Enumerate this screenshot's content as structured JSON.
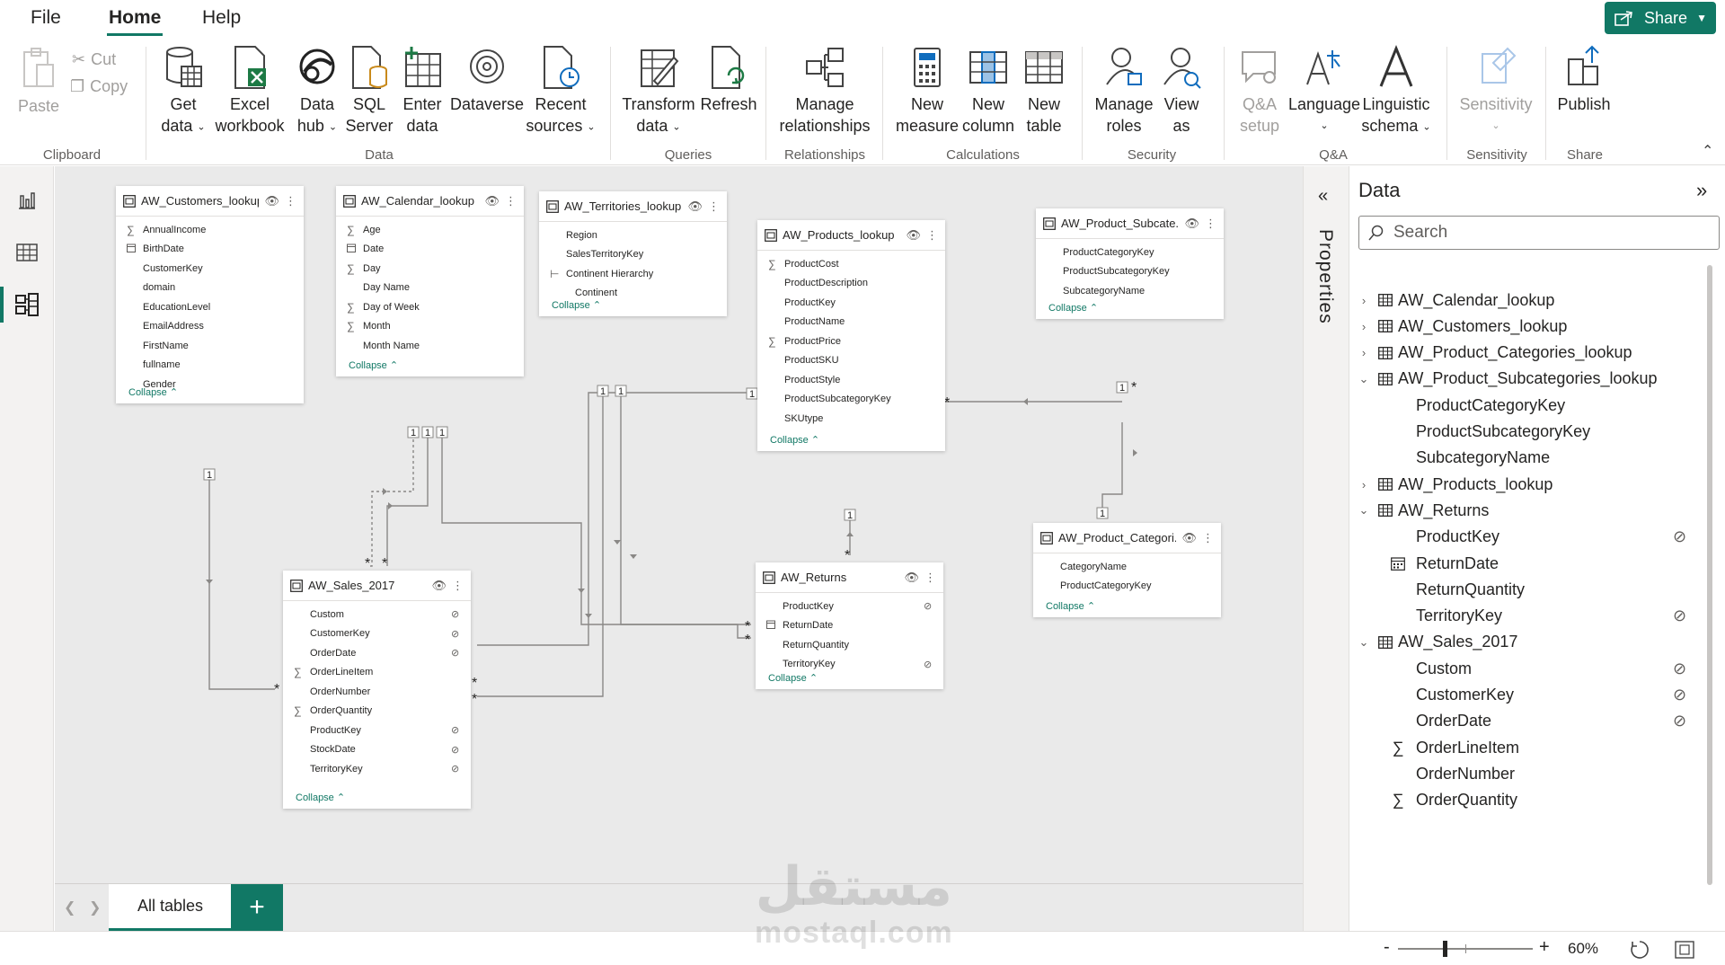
{
  "menu": {
    "tabs": [
      {
        "label": "File"
      },
      {
        "label": "Home"
      },
      {
        "label": "Help"
      }
    ],
    "share_label": "Share"
  },
  "ribbon": {
    "clipboard": {
      "paste": "Paste",
      "cut": "Cut",
      "copy": "Copy",
      "group": "Clipboard"
    },
    "data": {
      "get_data": [
        "Get",
        "data"
      ],
      "excel": [
        "Excel",
        "workbook"
      ],
      "data_hub": [
        "Data",
        "hub"
      ],
      "sql": [
        "SQL",
        "Server"
      ],
      "enter_data": [
        "Enter",
        "data"
      ],
      "dataverse": [
        "Dataverse",
        ""
      ],
      "recent": [
        "Recent",
        "sources"
      ],
      "group": "Data"
    },
    "queries": {
      "transform": [
        "Transform",
        "data"
      ],
      "refresh": [
        "Refresh",
        ""
      ],
      "group": "Queries"
    },
    "relationships": {
      "manage": [
        "Manage",
        "relationships"
      ],
      "group": "Relationships"
    },
    "calculations": {
      "new_measure": [
        "New",
        "measure"
      ],
      "new_column": [
        "New",
        "column"
      ],
      "new_table": [
        "New",
        "table"
      ],
      "group": "Calculations"
    },
    "security": {
      "manage_roles": [
        "Manage",
        "roles"
      ],
      "view_as": [
        "View",
        "as"
      ],
      "group": "Security"
    },
    "qa": {
      "qa_setup": [
        "Q&A",
        "setup"
      ],
      "language": [
        "Language",
        ""
      ],
      "linguistic": [
        "Linguistic",
        "schema"
      ],
      "group": "Q&A"
    },
    "sensitivity": {
      "label": [
        "Sensitivity",
        ""
      ],
      "group": "Sensitivity"
    },
    "share": {
      "publish": [
        "Publish",
        ""
      ],
      "group": "Share"
    }
  },
  "left_nav": [
    {
      "name": "report-view",
      "icon": "bar-chart-icon"
    },
    {
      "name": "table-view",
      "icon": "table-grid-icon"
    },
    {
      "name": "model-view",
      "icon": "model-diagram-icon"
    }
  ],
  "model": {
    "collapse_label": "Collapse",
    "tables": {
      "customers": {
        "title": "AW_Customers_lookup",
        "fields": [
          {
            "icon": "∑",
            "name": "AnnualIncome"
          },
          {
            "icon": "cal",
            "name": "BirthDate"
          },
          {
            "icon": "",
            "name": "CustomerKey"
          },
          {
            "icon": "",
            "name": "domain"
          },
          {
            "icon": "",
            "name": "EducationLevel"
          },
          {
            "icon": "",
            "name": "EmailAddress"
          },
          {
            "icon": "",
            "name": "FirstName"
          },
          {
            "icon": "",
            "name": "fullname"
          },
          {
            "icon": "",
            "name": "Gender"
          }
        ]
      },
      "calendar": {
        "title": "AW_Calendar_lookup",
        "fields": [
          {
            "icon": "∑",
            "name": "Age"
          },
          {
            "icon": "cal",
            "name": "Date"
          },
          {
            "icon": "∑",
            "name": "Day"
          },
          {
            "icon": "",
            "name": "Day Name"
          },
          {
            "icon": "∑",
            "name": "Day of Week"
          },
          {
            "icon": "∑",
            "name": "Month"
          },
          {
            "icon": "",
            "name": "Month Name"
          }
        ]
      },
      "territories": {
        "title": "AW_Territories_lookup",
        "fields": [
          {
            "icon": "",
            "name": "Region"
          },
          {
            "icon": "",
            "name": "SalesTerritoryKey"
          },
          {
            "icon": "hier",
            "name": "Continent Hierarchy"
          },
          {
            "icon": "",
            "name": "Continent",
            "indent": true
          }
        ]
      },
      "products": {
        "title": "AW_Products_lookup",
        "fields": [
          {
            "icon": "∑",
            "name": "ProductCost"
          },
          {
            "icon": "",
            "name": "ProductDescription"
          },
          {
            "icon": "",
            "name": "ProductKey"
          },
          {
            "icon": "",
            "name": "ProductName"
          },
          {
            "icon": "∑",
            "name": "ProductPrice"
          },
          {
            "icon": "",
            "name": "ProductSKU"
          },
          {
            "icon": "",
            "name": "ProductStyle"
          },
          {
            "icon": "",
            "name": "ProductSubcategoryKey"
          },
          {
            "icon": "",
            "name": "SKUtype"
          }
        ]
      },
      "subcategories": {
        "title": "AW_Product_Subcate...",
        "fields": [
          {
            "icon": "",
            "name": "ProductCategoryKey"
          },
          {
            "icon": "",
            "name": "ProductSubcategoryKey"
          },
          {
            "icon": "",
            "name": "SubcategoryName"
          }
        ]
      },
      "categories": {
        "title": "AW_Product_Categori...",
        "fields": [
          {
            "icon": "",
            "name": "CategoryName"
          },
          {
            "icon": "",
            "name": "ProductCategoryKey"
          }
        ]
      },
      "returns": {
        "title": "AW_Returns",
        "fields": [
          {
            "icon": "",
            "name": "ProductKey",
            "hidden": true
          },
          {
            "icon": "cal",
            "name": "ReturnDate"
          },
          {
            "icon": "",
            "name": "ReturnQuantity"
          },
          {
            "icon": "",
            "name": "TerritoryKey",
            "hidden": true
          }
        ]
      },
      "sales": {
        "title": "AW_Sales_2017",
        "fields": [
          {
            "icon": "",
            "name": "Custom",
            "hidden": true
          },
          {
            "icon": "",
            "name": "CustomerKey",
            "hidden": true
          },
          {
            "icon": "",
            "name": "OrderDate",
            "hidden": true
          },
          {
            "icon": "∑",
            "name": "OrderLineItem"
          },
          {
            "icon": "",
            "name": "OrderNumber"
          },
          {
            "icon": "∑",
            "name": "OrderQuantity"
          },
          {
            "icon": "",
            "name": "ProductKey",
            "hidden": true
          },
          {
            "icon": "",
            "name": "StockDate",
            "hidden": true
          },
          {
            "icon": "",
            "name": "TerritoryKey",
            "hidden": true
          }
        ]
      }
    },
    "cardinality": {
      "one": "1",
      "many": "*"
    }
  },
  "pages": {
    "all_tables": "All tables",
    "add": "+"
  },
  "properties_label": "Properties",
  "data_pane": {
    "title": "Data",
    "search_placeholder": "Search",
    "tree": [
      {
        "level": 0,
        "expanded": false,
        "label": "AW_Calendar_lookup"
      },
      {
        "level": 0,
        "expanded": false,
        "label": "AW_Customers_lookup"
      },
      {
        "level": 0,
        "expanded": false,
        "label": "AW_Product_Categories_lookup"
      },
      {
        "level": 0,
        "expanded": true,
        "label": "AW_Product_Subcategories_lookup"
      },
      {
        "level": 1,
        "icon": "",
        "label": "ProductCategoryKey"
      },
      {
        "level": 1,
        "icon": "",
        "label": "ProductSubcategoryKey"
      },
      {
        "level": 1,
        "icon": "",
        "label": "SubcategoryName"
      },
      {
        "level": 0,
        "expanded": false,
        "label": "AW_Products_lookup"
      },
      {
        "level": 0,
        "expanded": true,
        "label": "AW_Returns"
      },
      {
        "level": 1,
        "icon": "",
        "label": "ProductKey",
        "hidden": true
      },
      {
        "level": 1,
        "icon": "cal",
        "label": "ReturnDate"
      },
      {
        "level": 1,
        "icon": "",
        "label": "ReturnQuantity"
      },
      {
        "level": 1,
        "icon": "",
        "label": "TerritoryKey",
        "hidden": true
      },
      {
        "level": 0,
        "expanded": true,
        "label": "AW_Sales_2017"
      },
      {
        "level": 1,
        "icon": "",
        "label": "Custom",
        "hidden": true
      },
      {
        "level": 1,
        "icon": "",
        "label": "CustomerKey",
        "hidden": true
      },
      {
        "level": 1,
        "icon": "",
        "label": "OrderDate",
        "hidden": true
      },
      {
        "level": 1,
        "icon": "∑",
        "label": "OrderLineItem"
      },
      {
        "level": 1,
        "icon": "",
        "label": "OrderNumber"
      },
      {
        "level": 1,
        "icon": "∑",
        "label": "OrderQuantity"
      }
    ]
  },
  "status": {
    "zoom": "60%",
    "zoom_minus": "-",
    "zoom_plus": "+",
    "zoom_fraction": 0.6
  },
  "watermark": {
    "arabic": "مستقل",
    "latin": "mostaql.com"
  },
  "colors": {
    "accent": "#117865",
    "canvas": "#eaeaea",
    "pane_bg": "#f3f2f1"
  }
}
